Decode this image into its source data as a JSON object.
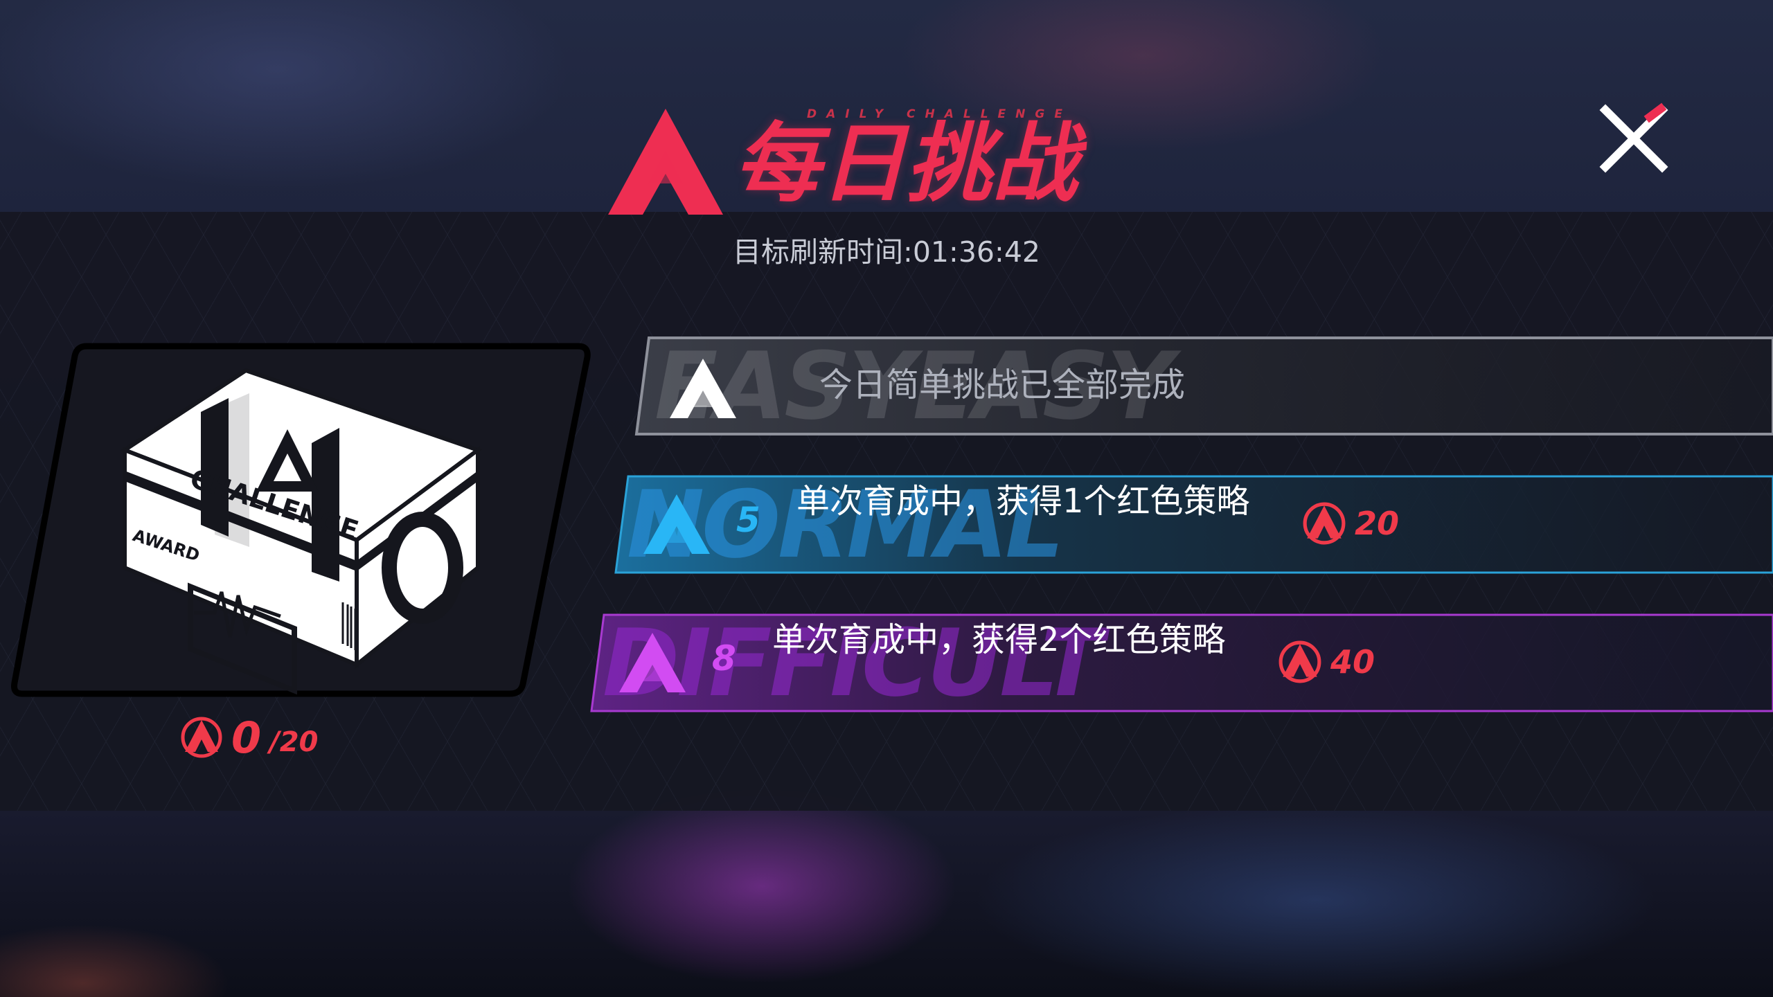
{
  "title": {
    "subtitle": "DAILY CHALLENGE",
    "main": "每日挑战"
  },
  "refresh": {
    "label": "目标刷新时间:",
    "time": "01:36:42"
  },
  "chest": {
    "box_text": "CHALLENGE",
    "box_sub": "AWARD",
    "progress_current": "0",
    "progress_total": "/20"
  },
  "challenges": {
    "easy": {
      "watermark": "EASYEASY",
      "status": "今日简单挑战已全部完成"
    },
    "normal": {
      "watermark": "NORMAL",
      "level": "5",
      "description": "单次育成中，获得1个红色策略",
      "reward": "20"
    },
    "difficult": {
      "watermark": "DIFFICULT",
      "level": "8",
      "description": "单次育成中，获得2个红色策略",
      "reward": "40"
    }
  },
  "icons": {
    "close": "close-icon",
    "logo": "challenge-logo-icon",
    "currency": "challenge-token-icon"
  },
  "colors": {
    "accent_red": "#ee2e52",
    "normal_blue": "#29b6f6",
    "difficult_purple": "#d24cf2",
    "easy_gray": "#aeb2bd"
  }
}
